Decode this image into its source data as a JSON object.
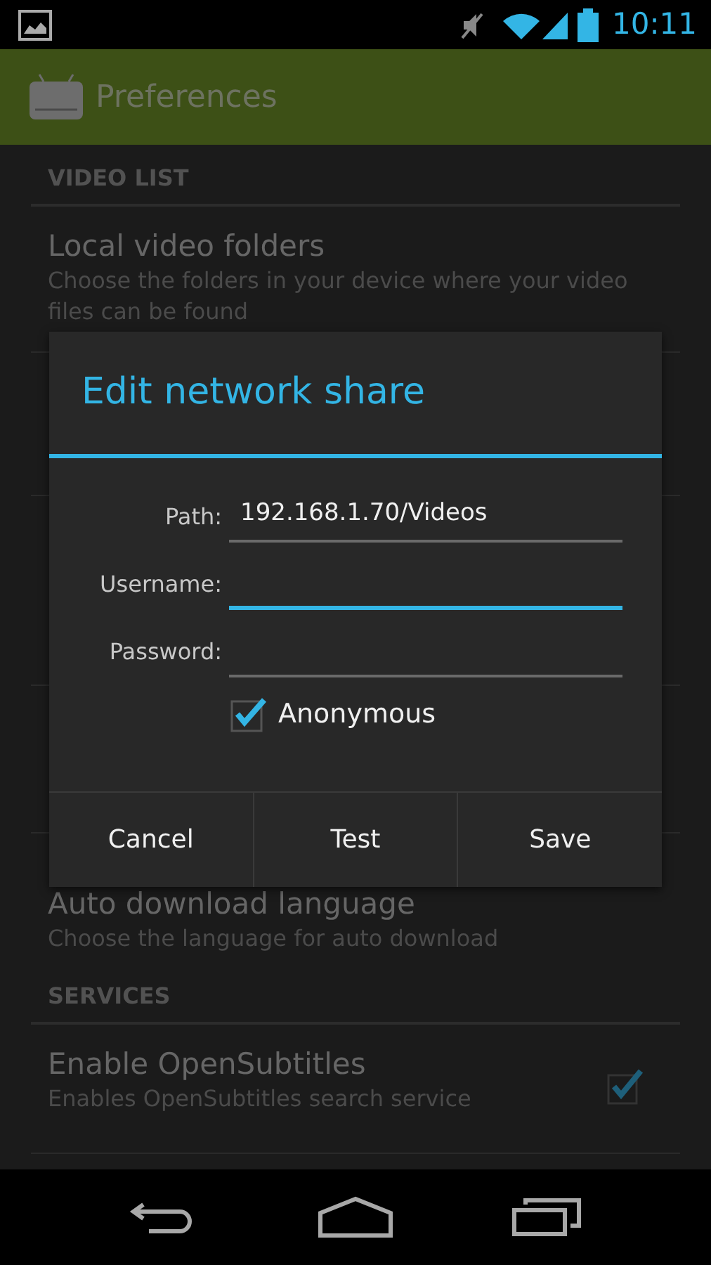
{
  "status_bar": {
    "time": "10:11"
  },
  "action_bar": {
    "title": "Preferences"
  },
  "list_top": [
    {
      "kind": "header",
      "title": "VIDEO LIST"
    },
    {
      "kind": "item",
      "title": "Local video folders",
      "summary": "Choose the folders in your device where your video files can be found"
    }
  ],
  "list_bottom": [
    {
      "kind": "item",
      "title": "Auto download language",
      "summary": "Choose the language for auto download"
    },
    {
      "kind": "header",
      "title": "SERVICES"
    },
    {
      "kind": "checkbox_item",
      "title": "Enable OpenSubtitles",
      "summary": "Enables OpenSubtitles search service",
      "checked": true
    }
  ],
  "dialog": {
    "title": "Edit network share",
    "fields": [
      {
        "label": "Path:",
        "value": "192.168.1.70/Videos",
        "focused": false
      },
      {
        "label": "Username:",
        "focused": true
      },
      {
        "label": "Password:",
        "focused": false
      }
    ],
    "anonymous": {
      "label": "Anonymous",
      "checked": true
    },
    "buttons": [
      "Cancel",
      "Test",
      "Save"
    ]
  }
}
